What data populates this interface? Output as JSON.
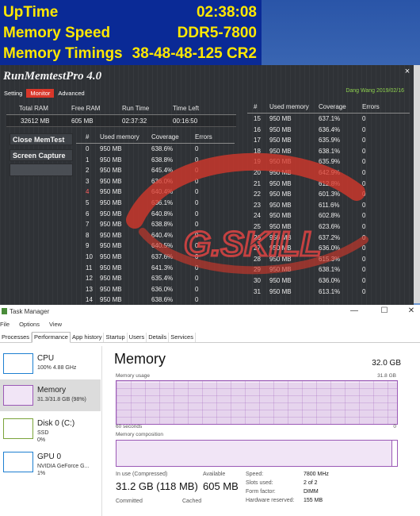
{
  "overlay": {
    "rows": [
      {
        "label": "UpTime",
        "value": "02:38:08"
      },
      {
        "label": "Memory Speed",
        "value": "DDR5-7800"
      },
      {
        "label": "Memory Timings",
        "value": "38-48-48-125 CR2"
      }
    ]
  },
  "memtest": {
    "title": "RunMemtestPro 4.0",
    "close": "×",
    "tabs": [
      "Setting",
      "Monitor",
      "Advanced"
    ],
    "active_tab": 1,
    "author": "Dang Wang 2019/02/16",
    "summary_headers": [
      "Total RAM",
      "Free RAM",
      "Run Time",
      "Time Left"
    ],
    "summary_values": [
      "32612 MB",
      "605 MB",
      "02:37:32",
      "00:16:50"
    ],
    "buttons": {
      "close": "Close MemTest",
      "capture": "Screen Capture"
    },
    "table_headers": [
      "#",
      "Used memory",
      "Coverage",
      "Errors"
    ],
    "threads_left": [
      {
        "n": "0",
        "used": "950 MB",
        "cov": "638.6%",
        "err": "0"
      },
      {
        "n": "1",
        "used": "950 MB",
        "cov": "638.8%",
        "err": "0"
      },
      {
        "n": "2",
        "used": "950 MB",
        "cov": "645.4%",
        "err": "0"
      },
      {
        "n": "3",
        "used": "950 MB",
        "cov": "636.0%",
        "err": "0"
      },
      {
        "n": "4",
        "used": "950 MB",
        "cov": "640.4%",
        "err": "0"
      },
      {
        "n": "5",
        "used": "950 MB",
        "cov": "636.1%",
        "err": "0"
      },
      {
        "n": "6",
        "used": "950 MB",
        "cov": "640.8%",
        "err": "0"
      },
      {
        "n": "7",
        "used": "950 MB",
        "cov": "638.8%",
        "err": "0"
      },
      {
        "n": "8",
        "used": "950 MB",
        "cov": "640.4%",
        "err": "0"
      },
      {
        "n": "9",
        "used": "950 MB",
        "cov": "640.5%",
        "err": "0"
      },
      {
        "n": "10",
        "used": "950 MB",
        "cov": "637.6%",
        "err": "0"
      },
      {
        "n": "11",
        "used": "950 MB",
        "cov": "641.3%",
        "err": "0"
      },
      {
        "n": "12",
        "used": "950 MB",
        "cov": "635.4%",
        "err": "0"
      },
      {
        "n": "13",
        "used": "950 MB",
        "cov": "636.0%",
        "err": "0"
      },
      {
        "n": "14",
        "used": "950 MB",
        "cov": "638.6%",
        "err": "0"
      }
    ],
    "threads_right": [
      {
        "n": "15",
        "used": "950 MB",
        "cov": "637.1%",
        "err": "0"
      },
      {
        "n": "16",
        "used": "950 MB",
        "cov": "636.4%",
        "err": "0"
      },
      {
        "n": "17",
        "used": "950 MB",
        "cov": "635.9%",
        "err": "0"
      },
      {
        "n": "18",
        "used": "950 MB",
        "cov": "638.1%",
        "err": "0"
      },
      {
        "n": "19",
        "used": "950 MB",
        "cov": "635.9%",
        "err": "0"
      },
      {
        "n": "20",
        "used": "950 MB",
        "cov": "642.9%",
        "err": "0"
      },
      {
        "n": "21",
        "used": "950 MB",
        "cov": "612.8%",
        "err": "0"
      },
      {
        "n": "22",
        "used": "950 MB",
        "cov": "601.3%",
        "err": "0"
      },
      {
        "n": "23",
        "used": "950 MB",
        "cov": "611.6%",
        "err": "0"
      },
      {
        "n": "24",
        "used": "950 MB",
        "cov": "602.8%",
        "err": "0"
      },
      {
        "n": "25",
        "used": "950 MB",
        "cov": "623.6%",
        "err": "0"
      },
      {
        "n": "26",
        "used": "950 MB",
        "cov": "637.2%",
        "err": "0"
      },
      {
        "n": "27",
        "used": "950 MB",
        "cov": "636.0%",
        "err": "0"
      },
      {
        "n": "28",
        "used": "950 MB",
        "cov": "615.3%",
        "err": "0"
      },
      {
        "n": "29",
        "used": "950 MB",
        "cov": "638.1%",
        "err": "0"
      },
      {
        "n": "30",
        "used": "950 MB",
        "cov": "636.0%",
        "err": "0"
      },
      {
        "n": "31",
        "used": "950 MB",
        "cov": "613.1%",
        "err": "0"
      }
    ],
    "logo_text": "G.SKILL",
    "accent_red": "#d9372a"
  },
  "taskmgr": {
    "title": "Task Manager",
    "controls": {
      "minimize": "—",
      "maximize": "☐",
      "close": "✕"
    },
    "menu": [
      "File",
      "Options",
      "View"
    ],
    "tabs": [
      "Processes",
      "Performance",
      "App history",
      "Startup",
      "Users",
      "Details",
      "Services"
    ],
    "active_tab": 1,
    "sidebar": [
      {
        "name": "CPU",
        "sub1": "100%  4.88 GHz",
        "sub2": "",
        "color": "#1e7fd1"
      },
      {
        "name": "Memory",
        "sub1": "31.3/31.8 GB (98%)",
        "sub2": "",
        "color": "#9b59b6"
      },
      {
        "name": "Disk 0 (C:)",
        "sub1": "SSD",
        "sub2": "0%",
        "color": "#7aa33a"
      },
      {
        "name": "GPU 0",
        "sub1": "NVIDIA GeForce G...",
        "sub2": "1%",
        "color": "#1e7fd1"
      }
    ],
    "heading": "Memory",
    "total": "32.0 GB",
    "usage_label": "Memory usage",
    "usage_max": "31.8 GB",
    "seconds_label": "60 seconds",
    "zero_label": "0",
    "composition_label": "Memory composition",
    "composition_used_fraction": 0.98,
    "in_use_label": "In use (Compressed)",
    "in_use_value": "31.2 GB (118 MB)",
    "available_label": "Available",
    "available_value": "605 MB",
    "committed_label": "Committed",
    "cached_label": "Cached",
    "details": [
      {
        "k": "Speed:",
        "v": "7800 MHz"
      },
      {
        "k": "Slots used:",
        "v": "2 of 2"
      },
      {
        "k": "Form factor:",
        "v": "DIMM"
      },
      {
        "k": "Hardware reserved:",
        "v": "155 MB"
      }
    ],
    "accent_purple": "#9b59b6"
  }
}
